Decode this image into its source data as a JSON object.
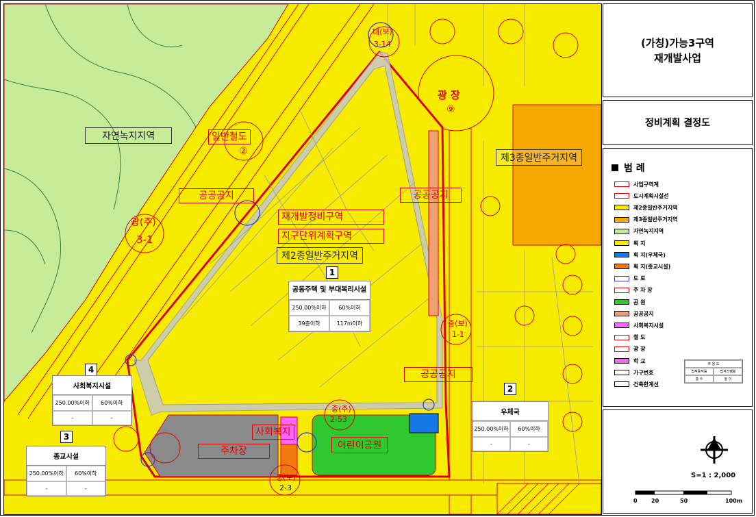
{
  "title_line1": "(가칭)가능3구역",
  "title_line2": "재개발사업",
  "subtitle": "정비계획 결정도",
  "legend": {
    "heading": "범    례",
    "items": [
      {
        "label": "사업구역계",
        "color": "#ffffff",
        "border": "#d00"
      },
      {
        "label": "도시계획시설선",
        "color": "#ffffff",
        "border": "#d00"
      },
      {
        "label": "제2종일반주거지역",
        "color": "#f7ec00",
        "border": "#000"
      },
      {
        "label": "제3종일반주거지역",
        "color": "#f5a800",
        "border": "#000"
      },
      {
        "label": "자연녹지지역",
        "color": "#c6ec9a",
        "border": "#000"
      },
      {
        "label": "획      지",
        "color": "#f7ec00",
        "border": "#000"
      },
      {
        "label": "획      지(우체국)",
        "color": "#1478e6",
        "border": "#000"
      },
      {
        "label": "획      지(종교시설)",
        "color": "#f07a10",
        "border": "#000"
      },
      {
        "label": "도      로",
        "color": "#ffffff",
        "border": "#33c"
      },
      {
        "label": "주  차  장",
        "color": "#ffffff",
        "border": "#d00"
      },
      {
        "label": "공      원",
        "color": "#2fc92f",
        "border": "#000"
      },
      {
        "label": "공공공지",
        "color": "#f0a070",
        "border": "#000"
      },
      {
        "label": "사회복지시설",
        "color": "#ff66ff",
        "border": "#000"
      },
      {
        "label": "철      도",
        "color": "#ffffff",
        "border": "#d00"
      },
      {
        "label": "광      장",
        "color": "#ffffff",
        "border": "#d00"
      },
      {
        "label": "학      교",
        "color": "#e070e0",
        "border": "#000"
      },
      {
        "label": "가구번호",
        "color": "#ffffff",
        "border": "#000"
      },
      {
        "label": "건축한계선",
        "color": "#ffffff",
        "border": "#000"
      }
    ],
    "mini_table": {
      "title": "주 용 도",
      "h1": "법적용적률",
      "h2": "법적건폐율",
      "v1": "층 수",
      "v2": "높 이"
    }
  },
  "scale_text": "S=1 : 2,000",
  "scale_ticks": [
    "0",
    "20",
    "50",
    "100m"
  ],
  "map_labels": {
    "natural_green": "자연녹지지역",
    "general_rail": "일반철도",
    "general_rail_no": "②",
    "public_space_1": "공공공지",
    "plaza": "광  장",
    "plaza_no": "⑨",
    "public_space_2": "공공공지",
    "public_space_3": "공공공지",
    "zone3": "제3종일반주거지역",
    "redevelop_zone": "재개발정비구역",
    "district_plan": "지구단위계획구역",
    "zone2": "제2종일반주거지역",
    "kids_park": "어린이공원",
    "parking": "주차장",
    "welfare": "사회복지",
    "road_main": "광(주)",
    "road_main_no": "3-1",
    "road_c1": "중(보)",
    "road_c1_no": "1-1",
    "road_c2": "중(주)",
    "road_c2_no": "2-53",
    "road_t1": "대(보)",
    "road_t1_no": "3-14",
    "road_bottom": "중(보)",
    "road_bottom_no": "2-3"
  },
  "blocks": [
    {
      "no": "1",
      "name": "공동주택 및 부대복리시설",
      "far": "250.00%이하",
      "bcr": "60%이하",
      "floors": "39층이하",
      "height": "117m이하"
    },
    {
      "no": "2",
      "name": "우체국",
      "far": "250.00%이하",
      "bcr": "60%이하",
      "floors": "-",
      "height": "-"
    },
    {
      "no": "3",
      "name": "종교시설",
      "far": "250.00%이하",
      "bcr": "60%이하",
      "floors": "-",
      "height": "-"
    },
    {
      "no": "4",
      "name": "사회복지시설",
      "far": "250.00%이하",
      "bcr": "60%이하",
      "floors": "-",
      "height": "-"
    }
  ]
}
